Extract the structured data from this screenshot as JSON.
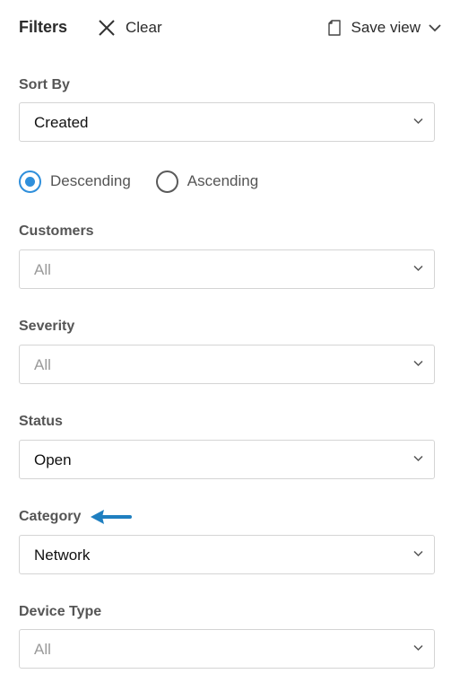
{
  "header": {
    "title": "Filters",
    "clear_label": "Clear",
    "save_view_label": "Save view"
  },
  "sort": {
    "label": "Sort By",
    "value": "Created",
    "order_options": [
      {
        "label": "Descending",
        "selected": true
      },
      {
        "label": "Ascending",
        "selected": false
      }
    ]
  },
  "customers": {
    "label": "Customers",
    "value": "All"
  },
  "severity": {
    "label": "Severity",
    "value": "All"
  },
  "status": {
    "label": "Status",
    "value": "Open"
  },
  "category": {
    "label": "Category",
    "value": "Network"
  },
  "device_type": {
    "label": "Device Type",
    "value": "All"
  },
  "colors": {
    "accent": "#2f8fdb",
    "annotation_arrow": "#1f7fc0"
  },
  "icons": [
    "close-icon",
    "document-icon",
    "chevron-down-icon",
    "caret-down-icon",
    "arrow-left-icon"
  ]
}
